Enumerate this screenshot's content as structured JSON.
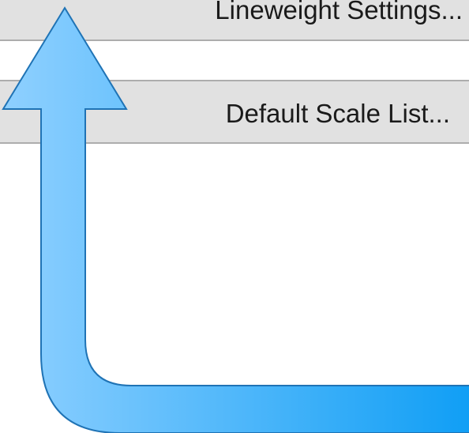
{
  "dialog": {
    "buttons": {
      "lineweight_settings": "Lineweight Settings...",
      "default_scale_list": "Default Scale List..."
    }
  },
  "annotation": {
    "arrow_icon": "callout-arrow-up-icon",
    "arrow_color_light": "#8fd0ff",
    "arrow_color_dark": "#0f9ef5",
    "arrow_outline": "#1f73b5"
  }
}
